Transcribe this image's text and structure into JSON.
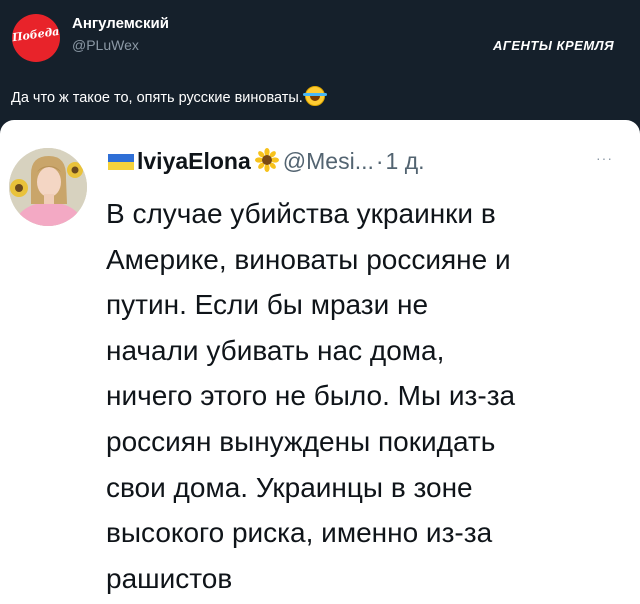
{
  "outer_post": {
    "author_name": "Ангулемский",
    "author_handle": "@PLuWex",
    "avatar_text": "Победа!",
    "text": "Да что ж такое то, опять русские виноваты.",
    "emoji": "face-with-tears-of-joy"
  },
  "watermark": "АГЕНТЫ КРЕМЛЯ",
  "quoted_post": {
    "author_name": "lviyaElona",
    "author_handle": "@Mesi...",
    "separator": "·",
    "time": "1 д.",
    "more": "···",
    "text": "В случае убийства украинки в\nАмерике, виноваты россияне и\nпутин. Если бы мрази не\nначали убивать нас дома,\nничего этого не было. Мы из-за\nроссиян вынуждены покидать\nсвои дома. Украинцы в зоне\nвысокого риска, именно из-за\nрашистов"
  },
  "colors": {
    "outer_background": "#15202b",
    "card_background": "#ffffff",
    "secondary_text": "#536471",
    "avatar_red": "#e8232a"
  },
  "icons": [
    "ukraine-flag-icon",
    "sunflower-icon",
    "more-icon",
    "laughing-emoji-icon"
  ]
}
